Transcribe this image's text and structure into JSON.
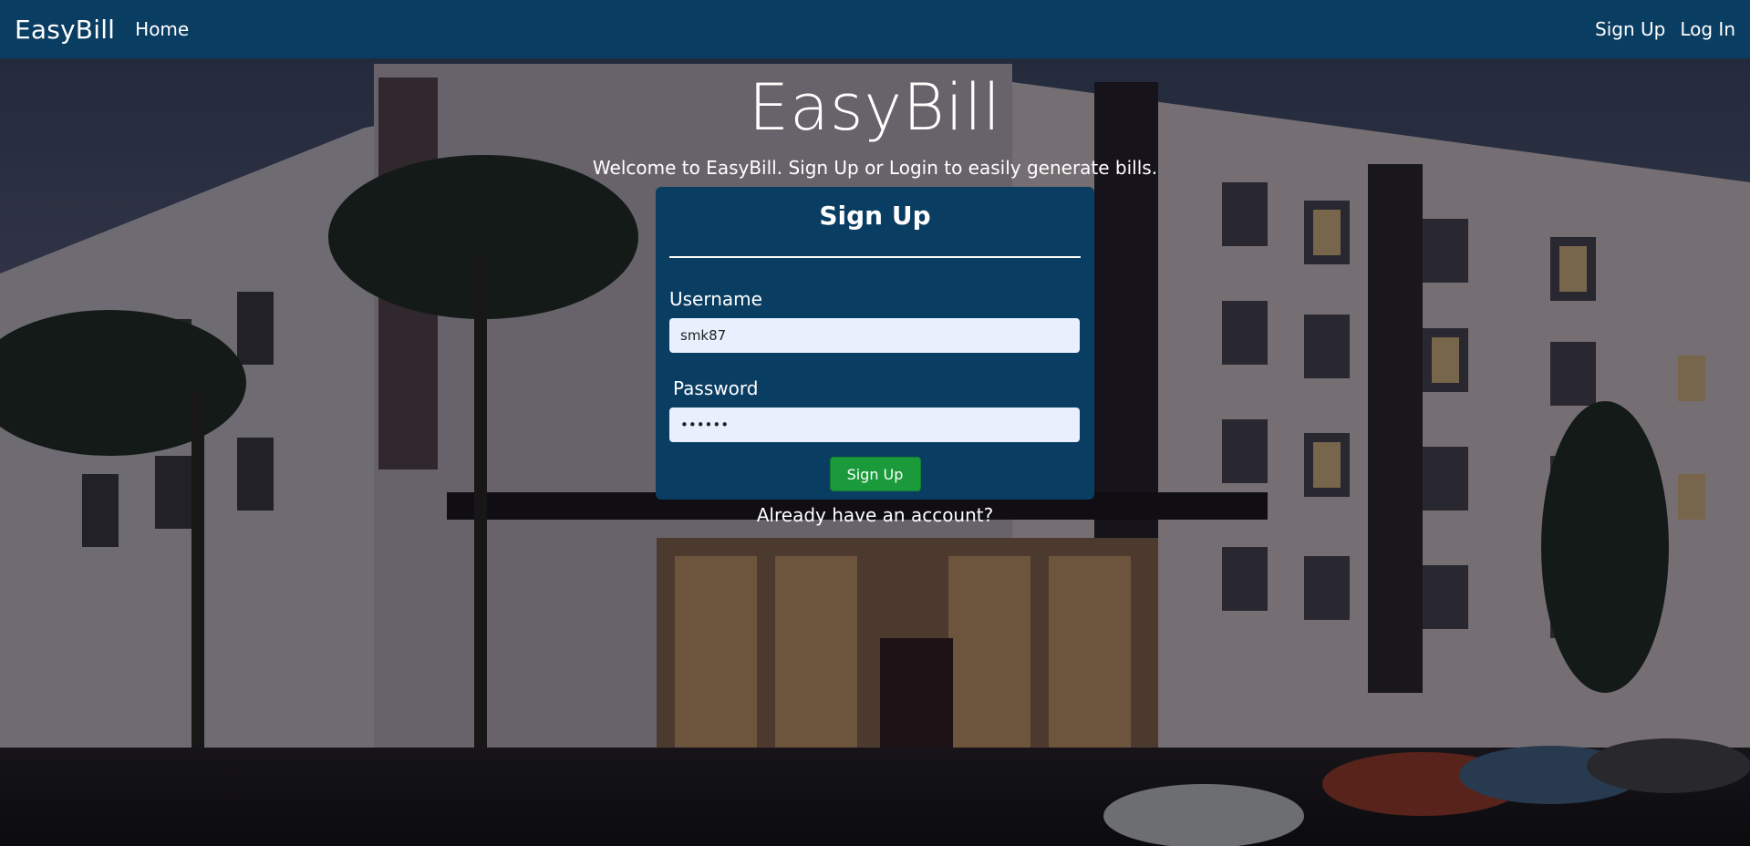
{
  "navbar": {
    "brand": "EasyBill",
    "home_label": "Home",
    "signup_label": "Sign Up",
    "login_label": "Log In",
    "background_color": "#0a3d62"
  },
  "hero": {
    "title": "EasyBill",
    "subtitle": "Welcome to EasyBill. Sign Up or Login to easily generate bills."
  },
  "signup_form": {
    "title": "Sign Up",
    "username_label": "Username",
    "username_value": "smk87",
    "password_label": "Password",
    "password_value": "••••••",
    "submit_label": "Sign Up",
    "submit_color": "#1a9a3a",
    "card_color": "#0a3d62"
  },
  "footer_link": {
    "label": "Already have an account?"
  },
  "background": {
    "icon": "apartment-building-dusk-photo"
  }
}
